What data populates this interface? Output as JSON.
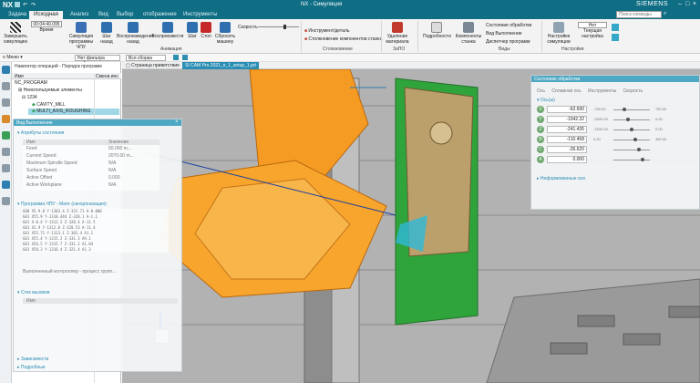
{
  "app": {
    "logo": "NX",
    "title": "NX - Симуляция",
    "brand": "SIEMENS"
  },
  "tabs": [
    "Задача",
    "Исходная",
    "Анализ",
    "Вид",
    "Выбор",
    "отображение",
    "Инструменты"
  ],
  "search_placeholder": "Поиск команды",
  "ribbon": {
    "finish": "Завершить симуляцию",
    "time_label": "Время",
    "time_value": "00:04:40.095",
    "sim_prog": "Симуляция программы ЧПУ",
    "step_back": "Шаг назад",
    "play_back": "Воспроизведение назад",
    "play": "Воспроизвести",
    "step": "Шаг",
    "stop": "Стоп",
    "reset": "Сбросить машину",
    "speed_label": "Скорость",
    "anim_group": "Анимация",
    "opt1": "Инструмент/деталь",
    "opt2": "Столкновение компонентов станка",
    "coll_group": "Столкновение",
    "remove": "Удаление материала",
    "zapo": "ЗаПО",
    "details": "Подробности",
    "components": "Компоненты станка",
    "v1": "Состояние обработки",
    "v2": "Вид Выполнение",
    "v3": "Диспетчер программ",
    "views_group": "Виды",
    "settings": "Настройки симуляции",
    "cur": "Текущая настройка",
    "nt": "Нет",
    "settings_group": "Настройки"
  },
  "quickbar": {
    "menu": "Меню",
    "filter": "Нет фильтра выбора",
    "assembly": "Вся сборка"
  },
  "navigator": {
    "title": "Навигатор операций - Порядок программ",
    "col_name": "Имя",
    "col_tool": "Смена инс",
    "items": [
      "NC_PROGRAM",
      "Неиспользуемые элементы",
      "1234",
      "CAVITY_MILL",
      "MULTI_AXIS_ROUGHING"
    ]
  },
  "doctabs": {
    "welcome": "Страница приветствие",
    "file": "SI CAM Pro 2021_o_1_setup_1.prt"
  },
  "exec": {
    "title": "Вид Выполнение",
    "attrs": "Атрибуты состояния",
    "col_name": "Имя",
    "col_val": "Значение",
    "rows": [
      [
        "Feed",
        "50.000 m..."
      ],
      [
        "Current Speed",
        "2070.00 m..."
      ],
      [
        "Maximum Spindle Speed",
        "N/A"
      ],
      [
        "Surface Speed",
        "N/A"
      ],
      [
        "Active Offset",
        "0.000"
      ],
      [
        "Active Workplane",
        "N/A"
      ]
    ],
    "program": "Программа ЧПУ - Мате (синхронизация)",
    "code": [
      "G00 X5.9.8 Y-1303.4 Z-331.71 A-0.000",
      "G01 X55.9 Y-1310.444 Z-320.1 A-1.1",
      "G01 X-0.4 Y-1312.2 Z-320.4 A-11.5",
      "G01 X2.9 Y-1312.8 Z-320.53 A-11.4",
      "G01 X55.71 Y-1313.1 Z-381.4 A1.1",
      "G01 X55.4 Y-1315.2 Z-331.3 A9.1",
      "G01 X56.5 Y-1315.7 Z-331.2 A1.84",
      "G01 X58.3 Y-1316.4 Z-321.4 A1.3"
    ],
    "status": "Выполненный контроллер - процесс групп...",
    "stack": "Стек вызовов",
    "stack_name": "Имя",
    "footer1": "Зависимости",
    "footer2": "Подробные"
  },
  "machine": {
    "title": "Состояние обработки",
    "tabs": [
      "Ось",
      "Сплавная ось",
      "Инструменты",
      "Скорость"
    ],
    "section": "Ось(ы)",
    "axes": [
      {
        "name": "X",
        "val": "-62.690"
      },
      {
        "name": "Y",
        "val": "-1042.32"
      },
      {
        "name": "Z",
        "val": "-241.435"
      },
      {
        "name": "B",
        "val": "-110.458"
      },
      {
        "name": "C",
        "val": "-26.620"
      },
      {
        "name": "A",
        "val": "0.000"
      }
    ],
    "ranges": [
      "-750.00",
      "750.00",
      "-2500.00",
      "0.00",
      "-1500.00",
      "0.00",
      "0.00",
      "360.00"
    ],
    "more": "Неформованные оси"
  }
}
